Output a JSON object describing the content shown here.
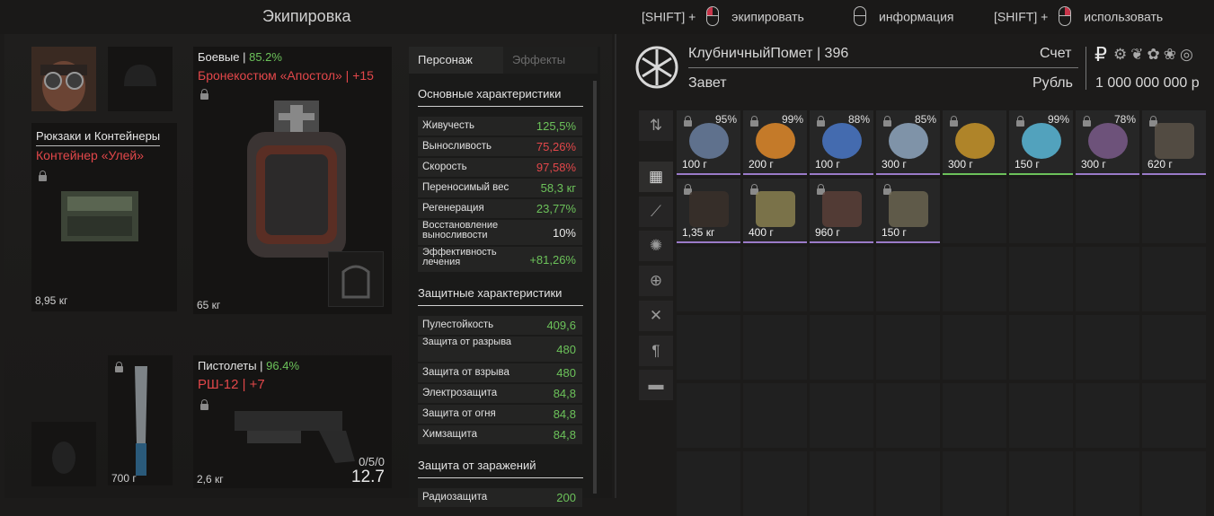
{
  "header": {
    "title": "Экипировка",
    "hints": [
      {
        "prefix": "[SHIFT] +",
        "mouse": "left",
        "label": "экипировать"
      },
      {
        "prefix": "",
        "mouse": "none",
        "label": "информация"
      },
      {
        "prefix": "[SHIFT] +",
        "mouse": "right",
        "label": "использовать"
      }
    ]
  },
  "equipment": {
    "backpack": {
      "category": "Рюкзаки и Контейнеры",
      "name": "Контейнер «Улей»",
      "weight": "8,95 кг"
    },
    "armor": {
      "category": "Боевые",
      "condition": "85.2%",
      "name": "Бронекостюм «Апостол»",
      "upgrade": "+15",
      "weight": "65 кг"
    },
    "knife": {
      "weight": "700 г"
    },
    "pistol": {
      "category": "Пистолеты",
      "condition": "96.4%",
      "name": "РШ-12",
      "upgrade": "+7",
      "weight": "2,6 кг",
      "ammo": "0/5/0",
      "caliber": "12.7"
    }
  },
  "stats": {
    "tabs": [
      "Персонаж",
      "Эффекты"
    ],
    "active_tab": "Персонаж",
    "sections": [
      {
        "title": "Основные характеристики",
        "rows": [
          {
            "name": "Живучесть",
            "value": "125,5%",
            "color": "#6cc25a"
          },
          {
            "name": "Выносливость",
            "value": "75,26%",
            "color": "#e2474a"
          },
          {
            "name": "Скорость",
            "value": "97,58%",
            "color": "#e2474a"
          },
          {
            "name": "Переносимый вес",
            "value": "58,3 кг",
            "color": "#6cc25a"
          },
          {
            "name": "Регенерация",
            "value": "23,77%",
            "color": "#6cc25a"
          },
          {
            "name": "Восстановление выносливости",
            "value": "10%",
            "color": "#e8e8e8"
          },
          {
            "name": "Эффективность лечения",
            "value": "+81,26%",
            "color": "#6cc25a"
          }
        ]
      },
      {
        "title": "Защитные характеристики",
        "rows": [
          {
            "name": "Пулестойкость",
            "value": "409,6",
            "color": "#6cc25a"
          },
          {
            "name": "Защита от разрыва",
            "value": "480",
            "color": "#6cc25a"
          },
          {
            "name": "Защита от взрыва",
            "value": "480",
            "color": "#6cc25a"
          },
          {
            "name": "Электрозащита",
            "value": "84,8",
            "color": "#6cc25a"
          },
          {
            "name": "Защита от огня",
            "value": "84,8",
            "color": "#6cc25a"
          },
          {
            "name": "Химзащита",
            "value": "84,8",
            "color": "#6cc25a"
          }
        ]
      },
      {
        "title": "Защита от заражений",
        "rows": [
          {
            "name": "Радиозащита",
            "value": "200",
            "color": "#6cc25a"
          }
        ]
      }
    ]
  },
  "player": {
    "name": "КлубничныйПомет",
    "separator": "|",
    "level": "396",
    "faction": "Завет",
    "account_label": "Счет",
    "currency_label": "Рубль",
    "balance": "1 000 000 000 р"
  },
  "inventory": {
    "items": [
      {
        "pct": "95%",
        "weight": "100 г",
        "color": "#9a7ac8",
        "icon": "claw-artifact-icon"
      },
      {
        "pct": "99%",
        "weight": "200 г",
        "color": "#9a7ac8",
        "icon": "fire-orb-artifact-icon"
      },
      {
        "pct": "88%",
        "weight": "100 г",
        "color": "#9a7ac8",
        "icon": "electric-orb-artifact-icon"
      },
      {
        "pct": "85%",
        "weight": "300 г",
        "color": "#9a7ac8",
        "icon": "crystal-artifact-icon"
      },
      {
        "pct": "",
        "weight": "300 г",
        "color": "#6cc25a",
        "icon": "amber-artifact-icon"
      },
      {
        "pct": "99%",
        "weight": "150 г",
        "color": "#6cc25a",
        "icon": "ice-artifact-icon"
      },
      {
        "pct": "78%",
        "weight": "300 г",
        "color": "#9a7ac8",
        "icon": "dark-artifact-icon"
      },
      {
        "pct": "",
        "weight": "620 г",
        "color": "#9a7ac8",
        "icon": "scope-icon"
      },
      {
        "pct": "",
        "weight": "1,35 кг",
        "color": "#9a7ac8",
        "icon": "grenade-launcher-icon"
      },
      {
        "pct": "",
        "weight": "400 г",
        "color": "#9a7ac8",
        "icon": "suppressor-icon"
      },
      {
        "pct": "",
        "weight": "960 г",
        "color": "#9a7ac8",
        "icon": "stock-icon"
      },
      {
        "pct": "",
        "weight": "150 г",
        "color": "#9a7ac8",
        "icon": "grip-icon"
      }
    ]
  }
}
